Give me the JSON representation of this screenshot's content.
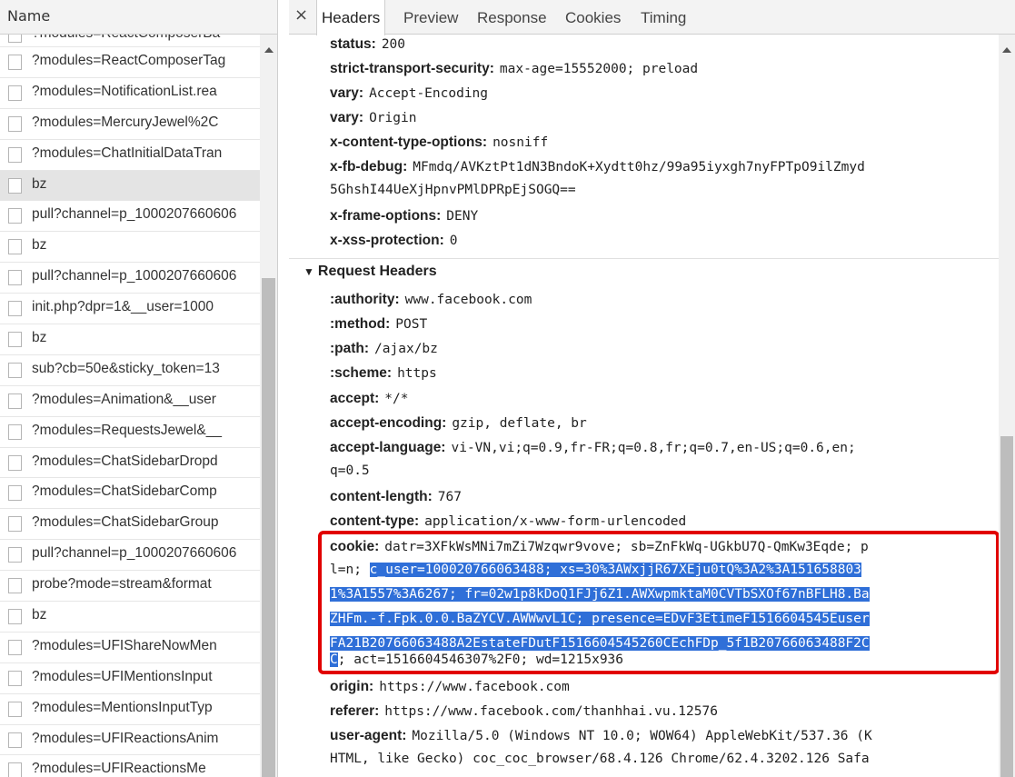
{
  "list": {
    "column_header": "Name",
    "top_partial_row": "?modules=ReactComposerBa",
    "rows": [
      {
        "name": "?modules=ReactComposerTag"
      },
      {
        "name": "?modules=NotificationList.rea"
      },
      {
        "name": "?modules=MercuryJewel%2C"
      },
      {
        "name": "?modules=ChatInitialDataTran"
      },
      {
        "name": "bz",
        "selected": true
      },
      {
        "name": "pull?channel=p_1000207660606"
      },
      {
        "name": "bz"
      },
      {
        "name": "pull?channel=p_1000207660606"
      },
      {
        "name": "init.php?dpr=1&__user=1000"
      },
      {
        "name": "bz"
      },
      {
        "name": "sub?cb=50e&sticky_token=13"
      },
      {
        "name": "?modules=Animation&__user"
      },
      {
        "name": "?modules=RequestsJewel&__"
      },
      {
        "name": "?modules=ChatSidebarDropd"
      },
      {
        "name": "?modules=ChatSidebarComp"
      },
      {
        "name": "?modules=ChatSidebarGroup"
      },
      {
        "name": "pull?channel=p_1000207660606"
      },
      {
        "name": "probe?mode=stream&format"
      },
      {
        "name": "bz"
      },
      {
        "name": "?modules=UFIShareNowMen"
      },
      {
        "name": "?modules=UFIMentionsInput"
      },
      {
        "name": "?modules=MentionsInputTyp"
      },
      {
        "name": "?modules=UFIReactionsAnim"
      },
      {
        "name": "?modules=UFIReactionsMe"
      }
    ]
  },
  "tabs": {
    "close": "×",
    "headers": "Headers",
    "preview": "Preview",
    "response": "Response",
    "cookies": "Cookies",
    "timing": "Timing"
  },
  "response_headers": [
    {
      "key": "status:",
      "value": "200"
    },
    {
      "key": "strict-transport-security:",
      "value": "max-age=15552000; preload"
    },
    {
      "key": "vary:",
      "value": "Accept-Encoding"
    },
    {
      "key": "vary:",
      "value": "Origin"
    },
    {
      "key": "x-content-type-options:",
      "value": "nosniff"
    },
    {
      "key": "x-fb-debug:",
      "value": "MFmdq/AVKztPt1dN3BndoK+Xydtt0hz/99a95iyxgh7nyFPTpO9ilZmyd"
    },
    {
      "key": "x-frame-options:",
      "value": "DENY"
    },
    {
      "key": "x-xss-protection:",
      "value": "0"
    }
  ],
  "x_fb_debug_cont": "5GhshI44UeXjHpnvPMlDPRpEjSOGQ==",
  "request_section_title": "Request Headers",
  "request_headers": [
    {
      "key": ":authority:",
      "value": "www.facebook.com"
    },
    {
      "key": ":method:",
      "value": "POST"
    },
    {
      "key": ":path:",
      "value": "/ajax/bz"
    },
    {
      "key": ":scheme:",
      "value": "https"
    },
    {
      "key": "accept:",
      "value": "*/*"
    },
    {
      "key": "accept-encoding:",
      "value": "gzip, deflate, br"
    },
    {
      "key": "accept-language:",
      "value": "vi-VN,vi;q=0.9,fr-FR;q=0.8,fr;q=0.7,en-US;q=0.6,en;"
    },
    {
      "key": "content-length:",
      "value": "767"
    },
    {
      "key": "content-type:",
      "value": "application/x-www-form-urlencoded"
    }
  ],
  "accept_language_cont": "q=0.5",
  "cookie": {
    "key": "cookie:",
    "line1": "datr=3XFkWsMNi7mZi7Wzqwr9vove; sb=ZnFkWq-UGkbU7Q-QmKw3Eqde; p",
    "line2_plain": "l=n; ",
    "line2_sel": "c_user=100020766063488; xs=30%3AWxjjR67XEju0tQ%3A2%3A151658803",
    "line3_sel": "1%3A1557%3A6267; fr=02w1p8kDoQ1FJj6Z1.AWXwpmktaM0CVTbSXOf67nBFLH8.Ba",
    "line4_sel": "ZHFm.-f.Fpk.0.0.BaZYCV.AWWwvL1C; presence=EDvF3EtimeF1516604545Euser",
    "line5_sel": "FA21B20766063488A2EstateFDutF1516604545260CEchFDp_5f1B20766063488F2C",
    "line6_sel": "C",
    "line6_plain": "; act=1516604546307%2F0; wd=1215x936"
  },
  "after_cookie": [
    {
      "key": "origin:",
      "value": "https://www.facebook.com"
    },
    {
      "key": "referer:",
      "value": "https://www.facebook.com/thanhhai.vu.12576"
    },
    {
      "key": "user-agent:",
      "value": "Mozilla/5.0 (Windows NT 10.0; WOW64) AppleWebKit/537.36 (K"
    }
  ],
  "user_agent_cont": "HTML, like Gecko) coc_coc_browser/68.4.126 Chrome/62.4.3202.126 Safa"
}
